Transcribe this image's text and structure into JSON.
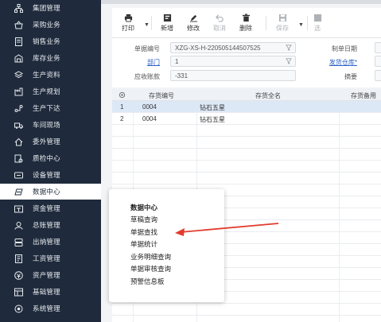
{
  "sidebar": {
    "items": [
      {
        "label": "集团管理",
        "icon": "org-tree-icon"
      },
      {
        "label": "采购业务",
        "icon": "shopping-basket-icon"
      },
      {
        "label": "销售业务",
        "icon": "receipt-icon"
      },
      {
        "label": "库存业务",
        "icon": "warehouse-icon"
      },
      {
        "label": "生产资料",
        "icon": "layers-icon"
      },
      {
        "label": "生产规划",
        "icon": "factory-icon"
      },
      {
        "label": "生产下达",
        "icon": "flow-icon"
      },
      {
        "label": "车间现场",
        "icon": "truck-icon"
      },
      {
        "label": "委外管理",
        "icon": "outsource-icon"
      },
      {
        "label": "质检中心",
        "icon": "inspection-icon"
      },
      {
        "label": "设备管理",
        "icon": "device-icon"
      },
      {
        "label": "数据中心",
        "icon": "data-center-icon"
      },
      {
        "label": "资金管理",
        "icon": "funds-icon"
      },
      {
        "label": "总账管理",
        "icon": "ledger-icon"
      },
      {
        "label": "出纳管理",
        "icon": "cashier-icon"
      },
      {
        "label": "工资管理",
        "icon": "payroll-icon"
      },
      {
        "label": "资产管理",
        "icon": "asset-icon"
      },
      {
        "label": "基础管理",
        "icon": "basic-settings-icon"
      },
      {
        "label": "系统管理",
        "icon": "system-gear-icon"
      }
    ],
    "active_index": 11
  },
  "toolbar": {
    "print": "打印",
    "new": "新增",
    "edit": "修改",
    "cancel": "取消",
    "delete": "删除",
    "save": "保存",
    "more": "选"
  },
  "form": {
    "doc_no_label": "单据编号",
    "doc_no_value": "XZG-XS-H-220505144507525",
    "department_label": "部门",
    "department_value": "1",
    "receivable_label": "应收账款",
    "receivable_value": "-331",
    "maker_date_label": "制单日期",
    "ship_warehouse_label": "发货仓库*",
    "summary_label": "摘要"
  },
  "grid": {
    "columns": [
      "存货编号",
      "存货全名",
      "存货备用"
    ],
    "rows": [
      {
        "no": "1",
        "code": "0004",
        "name": "钻石五星"
      },
      {
        "no": "2",
        "code": "0004",
        "name": "钻石五星"
      }
    ]
  },
  "popup": {
    "title": "数据中心",
    "items": [
      "草稿查询",
      "单据查找",
      "单据统计",
      "业务明细查询",
      "单据审核查询",
      "预警信息板"
    ]
  },
  "colors": {
    "sidebar_bg": "#1f2b3c",
    "link": "#2b63c7",
    "arrow": "#e23b2e",
    "selected_row": "#dde8f7"
  }
}
